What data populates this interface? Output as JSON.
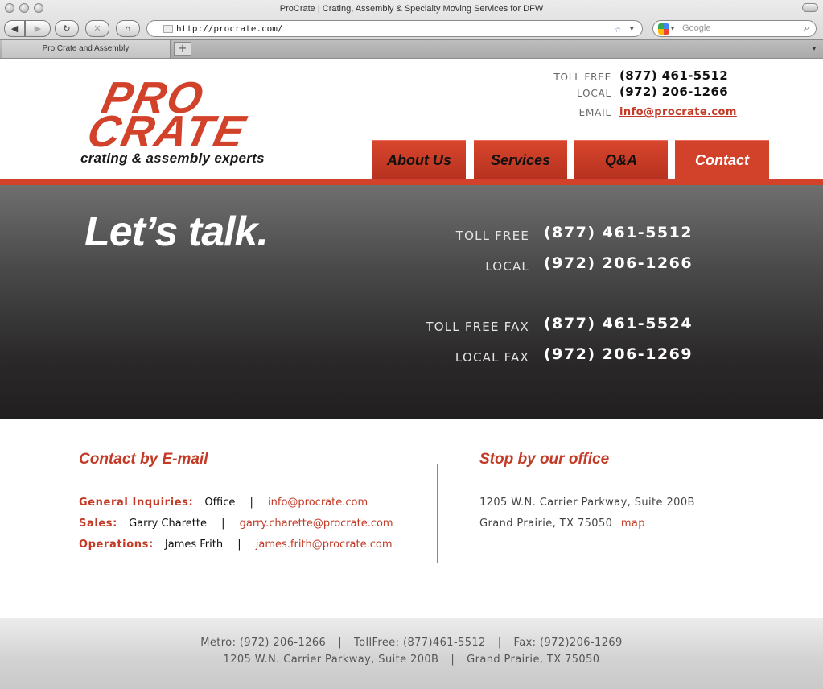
{
  "browser": {
    "window_title": "ProCrate | Crating, Assembly & Specialty Moving Services for DFW",
    "url": "http://procrate.com/",
    "search_placeholder": "Google",
    "tab_label": "Pro Crate and Assembly",
    "back_icon": "◀",
    "forward_icon": "▶",
    "reload_icon": "↻",
    "stop_icon": "✕",
    "home_icon": "⌂",
    "new_tab_icon": "+"
  },
  "header": {
    "logo_line1": "PRO",
    "logo_line2": "CRATE",
    "logo_tagline": "crating & assembly experts",
    "toll_free_label": "TOLL FREE",
    "toll_free_value": "(877) 461-5512",
    "local_label": "LOCAL",
    "local_value": "(972) 206-1266",
    "email_label": "EMAIL",
    "email_value": "info@procrate.com"
  },
  "nav": {
    "items": [
      {
        "label": "About Us",
        "active": false
      },
      {
        "label": "Services",
        "active": false
      },
      {
        "label": "Q&A",
        "active": false
      },
      {
        "label": "Contact",
        "active": true
      }
    ]
  },
  "hero": {
    "title": "Let’s talk.",
    "rows": [
      {
        "label": "TOLL FREE",
        "value": "(877) 461-5512"
      },
      {
        "label": "LOCAL",
        "value": "(972) 206-1266"
      },
      {
        "label": "TOLL FREE FAX",
        "value": "(877) 461-5524"
      },
      {
        "label": "LOCAL FAX",
        "value": "(972) 206-1269"
      }
    ]
  },
  "email_section": {
    "title": "Contact by E-mail",
    "rows": [
      {
        "label": "General Inquiries:",
        "person": "Office",
        "email": "info@procrate.com"
      },
      {
        "label": "Sales:",
        "person": "Garry Charette",
        "email": "garry.charette@procrate.com"
      },
      {
        "label": "Operations:",
        "person": "James Frith",
        "email": "james.frith@procrate.com"
      }
    ],
    "separator": "|"
  },
  "office_section": {
    "title": "Stop by our office",
    "address_line1": "1205 W.N. Carrier Parkway, Suite 200B",
    "address_line2": "Grand Prairie, TX 75050",
    "map_link": "map"
  },
  "footer": {
    "metro": "Metro: (972) 206-1266",
    "tollfree": "TollFree: (877)461-5512",
    "fax": "Fax: (972)206-1269",
    "address": "1205 W.N. Carrier Parkway, Suite 200B",
    "city": "Grand Prairie, TX 75050",
    "separator": "|"
  },
  "colors": {
    "brand_red": "#d2412a",
    "hero_dark": "#2a2829"
  }
}
